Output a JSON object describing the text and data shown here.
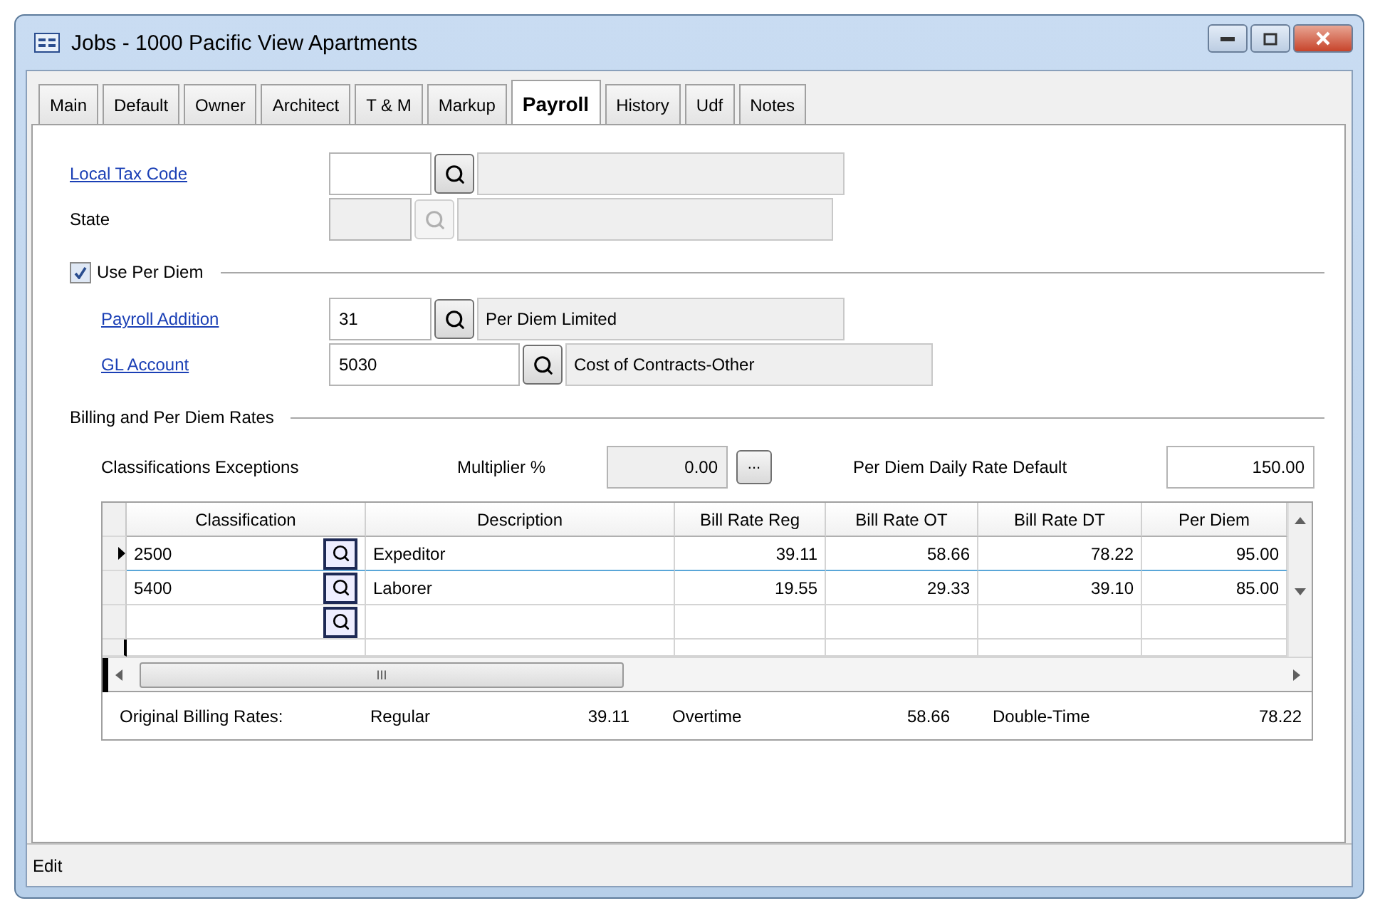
{
  "window": {
    "title": "Jobs - 1000  Pacific View Apartments"
  },
  "tabs": [
    {
      "label": "Main",
      "selected": false
    },
    {
      "label": "Default",
      "selected": false
    },
    {
      "label": "Owner",
      "selected": false
    },
    {
      "label": "Architect",
      "selected": false
    },
    {
      "label": "T & M",
      "selected": false
    },
    {
      "label": "Markup",
      "selected": false
    },
    {
      "label": "Payroll",
      "selected": true
    },
    {
      "label": "History",
      "selected": false
    },
    {
      "label": "Udf",
      "selected": false
    },
    {
      "label": "Notes",
      "selected": false
    }
  ],
  "lookups_top": [
    {
      "label": "Local Tax Code",
      "link": true,
      "disabled": false
    },
    {
      "label": "State",
      "link": false,
      "disabled": true
    }
  ],
  "use_per_diem": {
    "label": "Use Per Diem",
    "checked": true
  },
  "lookups_per_diem": [
    {
      "label": "Payroll Addition",
      "link": true,
      "disabled": false,
      "value": "31",
      "description": "Per Diem Limited"
    },
    {
      "label": "GL Account",
      "link": true,
      "disabled": false,
      "value": "5030",
      "description": "Cost of Contracts-Other"
    }
  ],
  "billing_section": {
    "title": "Billing and Per Diem Rates",
    "exceptions_label": "Classifications Exceptions",
    "multiplier_label": "Multiplier %",
    "multiplier_value": "0.00",
    "multiplier_button": "...",
    "default_rate_label": "Per Diem Daily Rate Default",
    "default_rate_value": "150.00"
  },
  "grid": {
    "columns": [
      "Classification",
      "Description",
      "Bill Rate Reg",
      "Bill Rate OT",
      "Bill Rate DT",
      "Per Diem"
    ],
    "rows": [
      {
        "selected": true,
        "classification": "2500",
        "description": "Expeditor",
        "bill_rate_reg": "39.11",
        "bill_rate_ot": "58.66",
        "bill_rate_dt": "78.22",
        "per_diem": "95.00"
      },
      {
        "selected": false,
        "classification": "5400",
        "description": "Laborer",
        "bill_rate_reg": "19.55",
        "bill_rate_ot": "29.33",
        "bill_rate_dt": "39.10",
        "per_diem": "85.00"
      }
    ],
    "scroll_grip": "III"
  },
  "original_rates": [
    {
      "kind": "heading",
      "text": "Original Billing Rates:"
    },
    {
      "kind": "label",
      "text": "Regular"
    },
    {
      "kind": "value",
      "text": "39.11"
    },
    {
      "kind": "label",
      "text": "Overtime"
    },
    {
      "kind": "value",
      "text": "58.66"
    },
    {
      "kind": "label",
      "text": "Double-Time"
    },
    {
      "kind": "value",
      "text": "78.22"
    }
  ],
  "status_bar": {
    "text": "Edit"
  }
}
